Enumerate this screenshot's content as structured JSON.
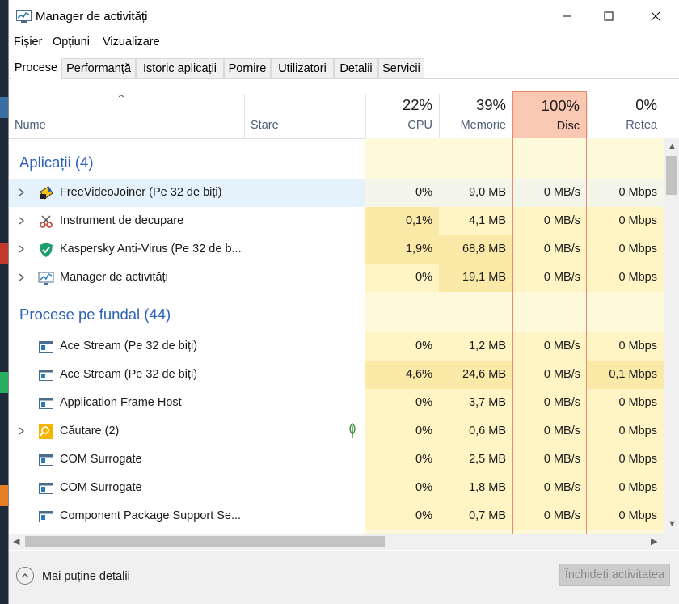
{
  "window": {
    "title": "Manager de activități",
    "minimize_icon": "minimize-icon",
    "maximize_icon": "maximize-icon",
    "close_icon": "close-icon"
  },
  "menu": [
    "Fișier",
    "Opțiuni",
    "Vizualizare"
  ],
  "tabs": [
    "Procese",
    "Performanță",
    "Istoric aplicații",
    "Pornire",
    "Utilizatori",
    "Detalii",
    "Servicii"
  ],
  "active_tab": "Procese",
  "columns": {
    "name": "Nume",
    "status": "Stare",
    "cpu": {
      "percent": "22%",
      "label": "CPU"
    },
    "memory": {
      "percent": "39%",
      "label": "Memorie"
    },
    "disk": {
      "percent": "100%",
      "label": "Disc"
    },
    "network": {
      "percent": "0%",
      "label": "Rețea"
    }
  },
  "groups": {
    "apps": "Aplicații (4)",
    "background": "Procese pe fundal (44)"
  },
  "apps": [
    {
      "name": "FreeVideoJoiner (Pe 32 de biți)",
      "cpu": "0%",
      "memory": "9,0 MB",
      "disk": "0 MB/s",
      "network": "0 Mbps",
      "icon": "freevideojoiner-icon"
    },
    {
      "name": "Instrument de decupare",
      "cpu": "0,1%",
      "memory": "4,1 MB",
      "disk": "0 MB/s",
      "network": "0 Mbps",
      "icon": "snipping-tool-icon"
    },
    {
      "name": "Kaspersky Anti-Virus (Pe 32 de b...",
      "cpu": "1,9%",
      "memory": "68,8 MB",
      "disk": "0 MB/s",
      "network": "0 Mbps",
      "icon": "kaspersky-shield-icon"
    },
    {
      "name": "Manager de activități",
      "cpu": "0%",
      "memory": "19,1 MB",
      "disk": "0 MB/s",
      "network": "0 Mbps",
      "icon": "task-manager-icon"
    }
  ],
  "background": [
    {
      "name": "Ace Stream (Pe 32 de biți)",
      "cpu": "0%",
      "memory": "1,2 MB",
      "disk": "0 MB/s",
      "network": "0 Mbps",
      "icon": "process-window-icon"
    },
    {
      "name": "Ace Stream (Pe 32 de biți)",
      "cpu": "4,6%",
      "memory": "24,6 MB",
      "disk": "0 MB/s",
      "network": "0,1 Mbps",
      "icon": "process-window-icon"
    },
    {
      "name": "Application Frame Host",
      "cpu": "0%",
      "memory": "3,7 MB",
      "disk": "0 MB/s",
      "network": "0 Mbps",
      "icon": "process-window-icon"
    },
    {
      "name": "Căutare (2)",
      "cpu": "0%",
      "memory": "0,6 MB",
      "disk": "0 MB/s",
      "network": "0 Mbps",
      "icon": "search-app-icon"
    },
    {
      "name": "COM Surrogate",
      "cpu": "0%",
      "memory": "2,5 MB",
      "disk": "0 MB/s",
      "network": "0 Mbps",
      "icon": "process-window-icon"
    },
    {
      "name": "COM Surrogate",
      "cpu": "0%",
      "memory": "1,8 MB",
      "disk": "0 MB/s",
      "network": "0 Mbps",
      "icon": "process-window-icon"
    },
    {
      "name": "Component Package Support Se...",
      "cpu": "0%",
      "memory": "0,7 MB",
      "disk": "0 MB/s",
      "network": "0 Mbps",
      "icon": "process-window-icon"
    }
  ],
  "footer": {
    "fewer_details": "Mai puține detalii",
    "end_task": "Închideți activitatea"
  },
  "colors": {
    "group_blue": "#2e62b5",
    "disk_header": "#fac7b3",
    "heat_light": "#fff4c4",
    "heat_mid": "#fbe9a8",
    "selection": "#e5f1fb"
  }
}
